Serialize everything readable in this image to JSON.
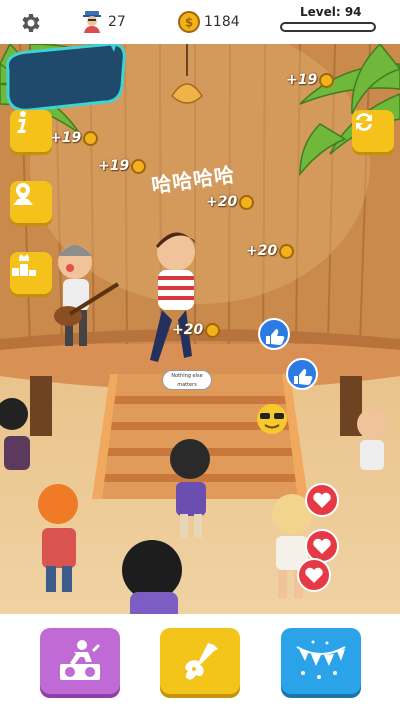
{
  "hud": {
    "players_count": "27",
    "coins": "1184",
    "level_label": "Level: 94",
    "level_progress": 0.0,
    "icons": [
      "gear-icon",
      "avatar-icon",
      "coin-icon"
    ]
  },
  "side_buttons": {
    "left": [
      "info-icon",
      "map-pin-icon",
      "podium-icon"
    ],
    "right": [
      "refresh-icon"
    ]
  },
  "floating_rewards": [
    {
      "text": "+19"
    },
    {
      "text": "+19"
    },
    {
      "text": "+19"
    },
    {
      "text": "+20"
    },
    {
      "text": "+20"
    },
    {
      "text": "+20"
    }
  ],
  "speech": {
    "main": "哈哈哈哈",
    "small": "Nothing else matters"
  },
  "reactions": [
    "thumbs-up-icon",
    "thumbs-up-icon",
    "sunglasses-emoji-icon",
    "heart-icon",
    "heart-icon",
    "heart-icon"
  ],
  "bottom_actions": [
    {
      "name": "dj-button",
      "icon": "dj-turntable-icon",
      "color": "#c06ad6"
    },
    {
      "name": "guitar-button",
      "icon": "electric-guitar-icon",
      "color": "#f3c51a"
    },
    {
      "name": "party-button",
      "icon": "bunting-flags-icon",
      "color": "#2aa3e8"
    }
  ],
  "colors": {
    "accent_yellow": "#f4c21b",
    "purple": "#c06ad6",
    "blue": "#2aa3e8",
    "like_blue": "#2c7be5",
    "heart_red": "#e53945"
  }
}
